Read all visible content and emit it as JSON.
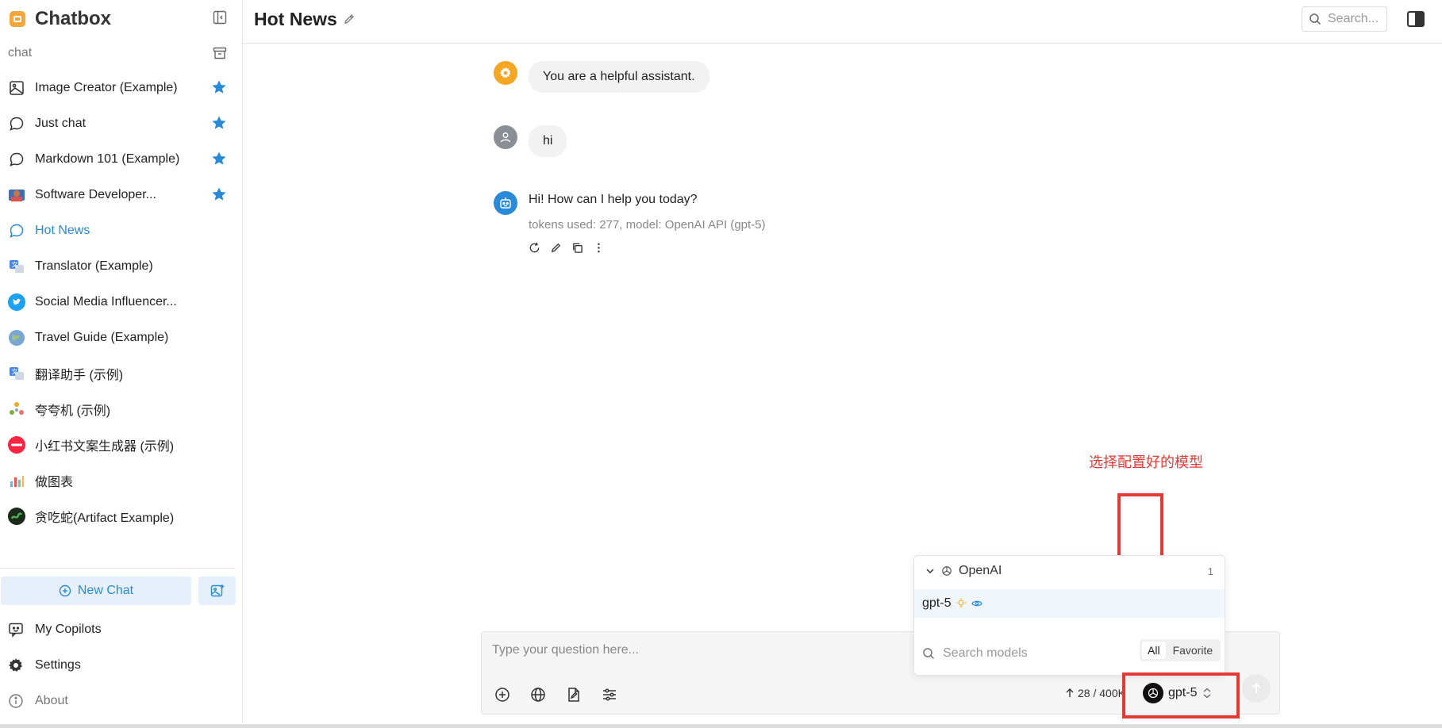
{
  "app": {
    "name": "Chatbox"
  },
  "sidebar": {
    "section_label": "chat",
    "items": [
      {
        "label": "Image Creator (Example)",
        "icon": "image-icon",
        "starred": true
      },
      {
        "label": "Just chat",
        "icon": "chat-bubble-icon",
        "starred": true
      },
      {
        "label": "Markdown 101 (Example)",
        "icon": "chat-bubble-icon",
        "starred": true
      },
      {
        "label": "Software Developer...",
        "icon": "software-developer-avatar",
        "starred": true
      },
      {
        "label": "Hot News",
        "icon": "chat-bubble-icon",
        "starred": false,
        "active": true
      },
      {
        "label": "Translator (Example)",
        "icon": "translator-avatar",
        "starred": false
      },
      {
        "label": "Social Media Influencer...",
        "icon": "twitter-avatar",
        "starred": false
      },
      {
        "label": "Travel Guide (Example)",
        "icon": "globe-avatar",
        "starred": false
      },
      {
        "label": "翻译助手 (示例)",
        "icon": "translator-avatar",
        "starred": false
      },
      {
        "label": "夸夸机 (示例)",
        "icon": "praise-avatar",
        "starred": false
      },
      {
        "label": "小红书文案生成器 (示例)",
        "icon": "xiaohongshu-avatar",
        "starred": false
      },
      {
        "label": "做图表",
        "icon": "chart-avatar",
        "starred": false
      },
      {
        "label": "贪吃蛇(Artifact Example)",
        "icon": "snake-avatar",
        "starred": false
      }
    ],
    "new_chat_label": "New Chat",
    "footer": {
      "copilots": "My Copilots",
      "settings": "Settings",
      "about": "About"
    }
  },
  "header": {
    "title": "Hot News",
    "search_label": "Search..."
  },
  "messages": {
    "system": "You are a helpful assistant.",
    "user": "hi",
    "assistant": "Hi! How can I help you today?",
    "assistant_meta": "tokens used: 277, model: OpenAI API (gpt-5)"
  },
  "annotation": {
    "text": "选择配置好的模型",
    "color": "#e53935"
  },
  "model_dropdown": {
    "provider": "OpenAI",
    "count": "1",
    "model": "gpt-5",
    "search_placeholder": "Search models",
    "tabs": [
      "All",
      "Favorite"
    ]
  },
  "input": {
    "placeholder": "Type your question here...",
    "token_count": "28 / 400K",
    "model": "gpt-5"
  },
  "colors": {
    "accent": "#2a8ad8",
    "star": "#2a8ad8",
    "annotation": "#e53935"
  }
}
